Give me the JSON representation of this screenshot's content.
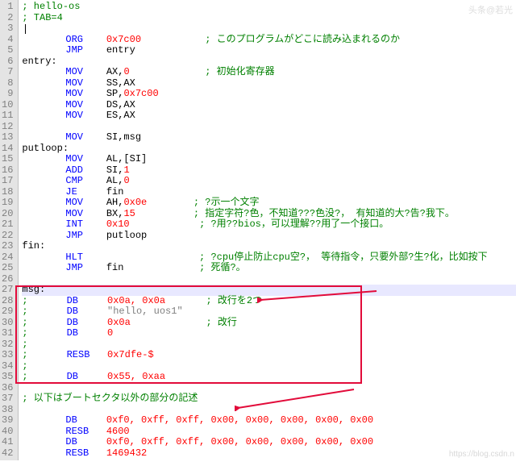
{
  "watermark": "头条@若光",
  "watermark2": "https://blog.csdn.n",
  "gutter": [
    "1",
    "2",
    "3",
    "4",
    "5",
    "6",
    "7",
    "8",
    "9",
    "10",
    "11",
    "12",
    "13",
    "14",
    "15",
    "16",
    "17",
    "18",
    "19",
    "20",
    "21",
    "22",
    "23",
    "24",
    "25",
    "26",
    "27",
    "28",
    "29",
    "30",
    "31",
    "32",
    "33",
    "34",
    "35",
    "36",
    "37",
    "38",
    "39",
    "40",
    "41",
    "42"
  ],
  "lines": {
    "l1": {
      "cmt": "; hello-os"
    },
    "l2": {
      "cmt": "; TAB=4"
    },
    "l4": {
      "kw": "ORG",
      "arg": "0x7c00",
      "cmt": "; このプログラムがどこに読み込まれるのか"
    },
    "l5": {
      "kw": "JMP",
      "arg": "entry"
    },
    "l6": {
      "lbl": "entry:"
    },
    "l7": {
      "kw": "MOV",
      "arg": "AX,",
      "n": "0",
      "cmt": "; 初始化寄存器"
    },
    "l8": {
      "kw": "MOV",
      "arg": "SS,AX"
    },
    "l9": {
      "kw": "MOV",
      "arg": "SP,",
      "n": "0x7c00"
    },
    "l10": {
      "kw": "MOV",
      "arg": "DS,AX"
    },
    "l11": {
      "kw": "MOV",
      "arg": "ES,AX"
    },
    "l13": {
      "kw": "MOV",
      "arg": "SI,msg"
    },
    "l14": {
      "lbl": "putloop:"
    },
    "l15": {
      "kw": "MOV",
      "arg": "AL,[SI]"
    },
    "l16": {
      "kw": "ADD",
      "arg": "SI,",
      "n": "1"
    },
    "l17": {
      "kw": "CMP",
      "arg": "AL,",
      "n": "0"
    },
    "l18": {
      "kw": "JE",
      "arg": "fin"
    },
    "l19": {
      "kw": "MOV",
      "arg": "AH,",
      "n": "0x0e",
      "cmt": "; ?示一个文字"
    },
    "l20": {
      "kw": "MOV",
      "arg": "BX,",
      "n": "15",
      "cmt": "; 指定字符?色，不知道???色没?， 有知道的大?告?我下。"
    },
    "l21": {
      "kw": "INT",
      "n": "0x10",
      "cmt": "; ?用??bios，可以理解??用了一个接口。"
    },
    "l22": {
      "kw": "JMP",
      "arg": "putloop"
    },
    "l23": {
      "lbl": "fin:"
    },
    "l24": {
      "kw": "HLT",
      "cmt": "; ?cpu停止防止cpu空?， 等待指令，只要外部?生?化，比如按下"
    },
    "l25": {
      "kw": "JMP",
      "arg": "fin",
      "cmt": "; 死循?。"
    },
    "l27": {
      "lbl": "msg:"
    },
    "l28": {
      "c": ";",
      "kw": "DB",
      "n": "0x0a, 0x0a",
      "cmt": "; 改行を2つ"
    },
    "l29": {
      "c": ";",
      "kw": "DB",
      "s": "\"hello, uos1\""
    },
    "l30": {
      "c": ";",
      "kw": "DB",
      "n": "0x0a",
      "cmt": "; 改行"
    },
    "l31": {
      "c": ";",
      "kw": "DB",
      "n": "0"
    },
    "l32": {
      "c": ";"
    },
    "l33": {
      "c": ";",
      "kw": "RESB",
      "n": "0x7dfe-$"
    },
    "l34": {
      "c": ";"
    },
    "l35": {
      "c": ";",
      "kw": "DB",
      "n": "0x55, 0xaa"
    },
    "l37": {
      "cmt": "; 以下はブートセクタ以外の部分の記述"
    },
    "l39": {
      "kw": "DB",
      "n": "0xf0, 0xff, 0xff, 0x00, 0x00, 0x00, 0x00, 0x00"
    },
    "l40": {
      "kw": "RESB",
      "n": "4600"
    },
    "l41": {
      "kw": "DB",
      "n": "0xf0, 0xff, 0xff, 0x00, 0x00, 0x00, 0x00, 0x00"
    },
    "l42": {
      "kw": "RESB",
      "n": "1469432"
    }
  }
}
